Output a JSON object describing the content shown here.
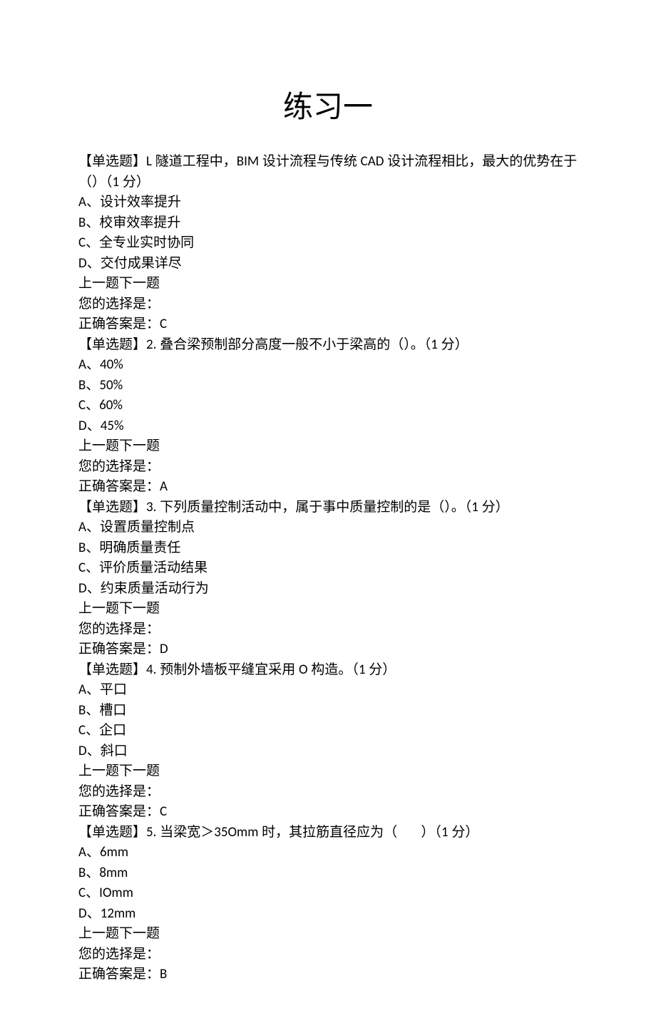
{
  "title": "练习一",
  "questions": [
    {
      "tag": "【单选题】",
      "number": "L",
      "stem_line1": "隧道工程中，BIM 设计流程与传统 CAD 设计流程相比，最大的优势在于",
      "stem_line2": "（）（1 分）",
      "options": [
        "A、设计效率提升",
        "B、校审效率提升",
        "C、全专业实时协同",
        "D、交付成果详尽"
      ],
      "nav": "上一题下一题",
      "choice_label": "您的选择是：",
      "answer_label": "正确答案是：",
      "answer": "C"
    },
    {
      "tag": "【单选题】",
      "number": "2.",
      "stem_line1": "叠合梁预制部分高度一般不小于梁高的（）。（1 分）",
      "options": [
        "A、40%",
        "B、50%",
        "C、60%",
        "D、45%"
      ],
      "nav": "上一题下一题",
      "choice_label": "您的选择是：",
      "answer_label": "正确答案是：",
      "answer": "A"
    },
    {
      "tag": "【单选题】",
      "number": "3.",
      "stem_line1": "下列质量控制活动中，属于事中质量控制的是（）。（1 分）",
      "options": [
        "A、设置质量控制点",
        "B、明确质量责任",
        "C、评价质量活动结果",
        "D、约束质量活动行为"
      ],
      "nav": "上一题下一题",
      "choice_label": "您的选择是：",
      "answer_label": "正确答案是：",
      "answer": "D"
    },
    {
      "tag": "【单选题】",
      "number": "4.",
      "stem_line1": "预制外墙板平缝宜采用 O 构造。（1 分）",
      "options": [
        "A、平口",
        "B、槽口",
        "C、企口",
        "D、斜口"
      ],
      "nav": "上一题下一题",
      "choice_label": "您的选择是：",
      "answer_label": "正确答案是：",
      "answer": "C"
    },
    {
      "tag": "【单选题】",
      "number": "5.",
      "stem_line1": "当梁宽＞35Omm 时，其拉筋直径应为（       ）（1 分）",
      "options": [
        "A、6mm",
        "B、8mm",
        "C、IOmm",
        "D、12mm"
      ],
      "nav": "上一题下一题",
      "choice_label": "您的选择是：",
      "answer_label": "正确答案是：",
      "answer": "B"
    }
  ]
}
